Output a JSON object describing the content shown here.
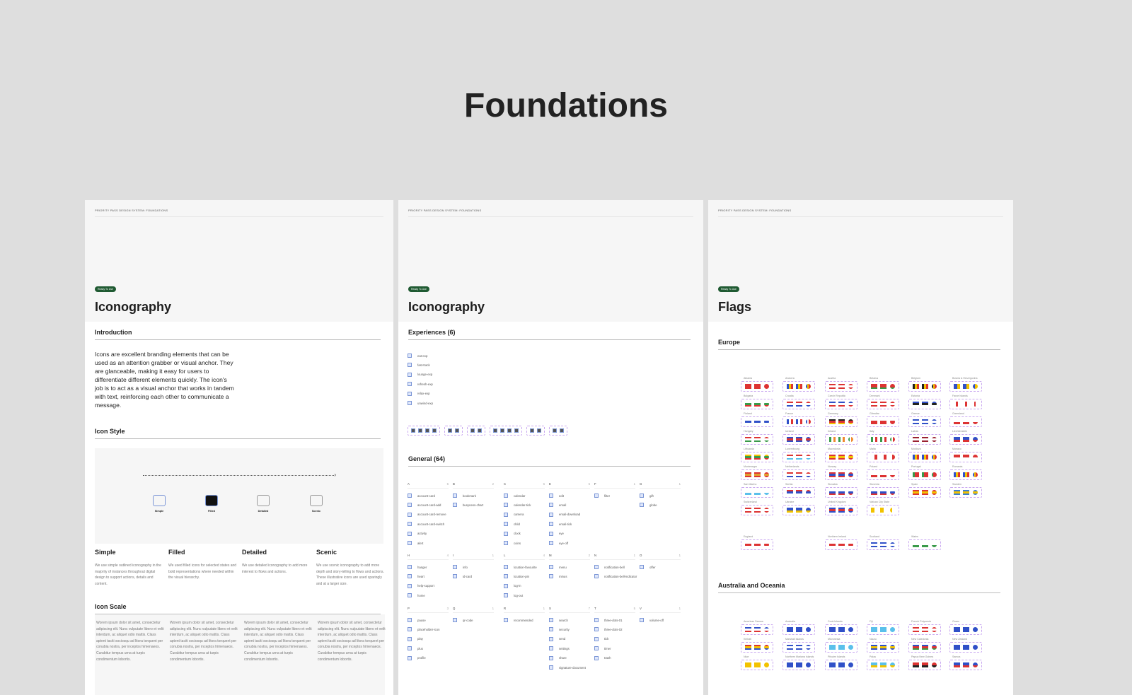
{
  "page_title": "Foundations",
  "panels": [
    {
      "breadcrumb": "PRIORITY PASS DESIGN SYSTEM: FOUNDATIONS",
      "badge": "Ready To Use",
      "title": "Iconography",
      "intro_heading": "Introduction",
      "intro_text": "Icons are excellent branding elements that can be used as an attention grabber or visual anchor. They are glanceable, making it easy for users to differentiate different elements quickly. The icon's job is to act as a visual anchor that works in tandem with text, reinforcing each other to communicate a message.",
      "style_heading": "Icon Style",
      "styles": [
        {
          "label": "Simple",
          "heading": "Simple",
          "text": "We use simple outlined iconography in the majority of instances throughout digital design to support actions, details and content."
        },
        {
          "label": "Filled",
          "heading": "Filled",
          "text": "We used filled icons for selected states and bold representations where needed within the visual hierarchy."
        },
        {
          "label": "Detailed",
          "heading": "Detailed",
          "text": "We use detailed iconography to add more interest to flows and actions."
        },
        {
          "label": "Scenic",
          "heading": "Scenic",
          "text": "We use scenic iconography to add more depth and story-telling to flows and actions. These illustrative icons are used sparingly and at a larger size."
        }
      ],
      "scale_heading": "Icon Scale",
      "scale_texts": [
        "Worem ipsum dolor sit amet, consectetur adipiscing elit. Nunc vulputate libero et velit interdum, ac aliquet odio mattis. Class aptent taciti sociosqu ad litora torquent per conubia nostra, per inceptos himenaeos. Curabitur tempus urna at turpis condimentum lobortis.",
        "Worem ipsum dolor sit amet, consectetur adipiscing elit. Nunc vulputate libero et velit interdum, ac aliquet odio mattis. Class aptent taciti sociosqu ad litora torquent per conubia nostra, per inceptos himenaeos. Curabitur tempus urna at turpis condimentum lobortis.",
        "Worem ipsum dolor sit amet, consectetur adipiscing elit. Nunc vulputate libero et velit interdum, ac aliquet odio mattis. Class aptent taciti sociosqu ad litora torquent per conubia nostra, per inceptos himenaeos. Curabitur tempus urna at turpis condimentum lobortis.",
        "Worem ipsum dolor sit amet, consectetur adipiscing elit. Nunc vulputate libero et velit interdum, ac aliquet odio mattis. Class aptent taciti sociosqu ad litora torquent per conubia nostra, per inceptos himenaeos. Curabitur tempus urna at turpis condimentum lobortis."
      ]
    },
    {
      "breadcrumb": "PRIORITY PASS DESIGN SYSTEM: FOUNDATIONS",
      "badge": "Ready To Use",
      "title": "Iconography",
      "experiences_heading": "Experiences (6)",
      "experiences": [
        "eat-exp",
        "fast-track",
        "lounge-exp",
        "refresh-exp",
        "relax-exp",
        "unwind-exp"
      ],
      "general_heading": "General (64)",
      "groups": [
        {
          "letter": "A",
          "count": "6",
          "items": [
            "account-card",
            "account-card-add",
            "account-card-remove",
            "account-card-switch",
            "activity",
            "alert"
          ]
        },
        {
          "letter": "B",
          "count": "2",
          "items": [
            "bookmark",
            "busyness-chart"
          ]
        },
        {
          "letter": "C",
          "count": "6",
          "items": [
            "calendar",
            "calendar-tick",
            "camera",
            "child",
            "clock",
            "coins"
          ]
        },
        {
          "letter": "E",
          "count": "6",
          "items": [
            "edit",
            "email",
            "email-download",
            "email-tick",
            "eye",
            "eye-off"
          ]
        },
        {
          "letter": "F",
          "count": "1",
          "items": [
            "filter"
          ]
        },
        {
          "letter": "G",
          "count": "1",
          "items": [
            "gift",
            "globe"
          ]
        },
        {
          "letter": "H",
          "count": "4",
          "items": [
            "hanger",
            "heart",
            "help-support",
            "home"
          ]
        },
        {
          "letter": "I",
          "count": "1",
          "items": [
            "info",
            "id-card"
          ]
        },
        {
          "letter": "L",
          "count": "4",
          "items": [
            "location-favourite",
            "location-pin",
            "log-in",
            "log-out"
          ]
        },
        {
          "letter": "M",
          "count": "2",
          "items": [
            "menu",
            "minus"
          ]
        },
        {
          "letter": "N",
          "count": "1",
          "items": [
            "notification-bell",
            "notification-bell-indicator"
          ]
        },
        {
          "letter": "O",
          "count": "1",
          "items": [
            "offer"
          ]
        },
        {
          "letter": "P",
          "count": "3",
          "items": [
            "pause",
            "placeholder-icon",
            "play",
            "plus",
            "profile"
          ]
        },
        {
          "letter": "Q",
          "count": "1",
          "items": [
            "qr-code"
          ]
        },
        {
          "letter": "R",
          "count": "1",
          "items": [
            "recommended"
          ]
        },
        {
          "letter": "S",
          "count": "7",
          "items": [
            "search",
            "security",
            "send",
            "settings",
            "share",
            "signature-document"
          ]
        },
        {
          "letter": "T",
          "count": "5",
          "items": [
            "three-dots-01",
            "three-dots-02",
            "tick",
            "timer",
            "trash"
          ]
        },
        {
          "letter": "V",
          "count": "1",
          "items": [
            "volume-off"
          ]
        }
      ]
    },
    {
      "breadcrumb": "PRIORITY PASS DESIGN SYSTEM: FOUNDATIONS",
      "badge": "Ready To Use",
      "title": "Flags",
      "europe_heading": "Europe",
      "europe": [
        {
          "name": "Albania",
          "c": [
            "#d33",
            "#d33"
          ]
        },
        {
          "name": "Andorra",
          "c": [
            "#3050c8",
            "#f2c200",
            "#d33"
          ],
          "v": 1
        },
        {
          "name": "Austria",
          "c": [
            "#d33",
            "#fff",
            "#d33"
          ]
        },
        {
          "name": "Belarus",
          "c": [
            "#d33",
            "#d33",
            "#3a9a4a"
          ]
        },
        {
          "name": "Belgium",
          "c": [
            "#222",
            "#f2c200",
            "#d33"
          ],
          "v": 1
        },
        {
          "name": "Bosnia & Herzegovina",
          "c": [
            "#3050c8",
            "#f2c200"
          ],
          "v": 1
        },
        {
          "name": "Bulgaria",
          "c": [
            "#fff",
            "#3a9a4a",
            "#d33"
          ]
        },
        {
          "name": "Croatia",
          "c": [
            "#d33",
            "#fff",
            "#3050c8"
          ]
        },
        {
          "name": "Czech Republic",
          "c": [
            "#3050c8",
            "#fff",
            "#d33"
          ]
        },
        {
          "name": "Denmark",
          "c": [
            "#d33",
            "#fff",
            "#d33"
          ]
        },
        {
          "name": "Estonia",
          "c": [
            "#3050c8",
            "#222",
            "#fff"
          ]
        },
        {
          "name": "Faroe Islands",
          "c": [
            "#fff",
            "#d33",
            "#fff"
          ],
          "v": 1
        },
        {
          "name": "Finland",
          "c": [
            "#fff",
            "#3050c8",
            "#fff"
          ]
        },
        {
          "name": "France",
          "c": [
            "#3050c8",
            "#fff",
            "#d33"
          ],
          "v": 1
        },
        {
          "name": "Germany",
          "c": [
            "#222",
            "#d33",
            "#f2c200"
          ]
        },
        {
          "name": "Gibraltar",
          "c": [
            "#fff",
            "#d33",
            "#d33"
          ]
        },
        {
          "name": "Greece",
          "c": [
            "#3050c8",
            "#fff",
            "#3050c8"
          ]
        },
        {
          "name": "Greenland",
          "c": [
            "#fff",
            "#d33"
          ]
        },
        {
          "name": "Hungary",
          "c": [
            "#d33",
            "#fff",
            "#3a9a4a"
          ]
        },
        {
          "name": "Iceland",
          "c": [
            "#3050c8",
            "#d33",
            "#3050c8"
          ]
        },
        {
          "name": "Ireland",
          "c": [
            "#3a9a4a",
            "#fff",
            "#f08a30"
          ],
          "v": 1
        },
        {
          "name": "Italy",
          "c": [
            "#3a9a4a",
            "#fff",
            "#d33"
          ],
          "v": 1
        },
        {
          "name": "Latvia",
          "c": [
            "#9b2232",
            "#fff",
            "#9b2232"
          ]
        },
        {
          "name": "Liechtenstein",
          "c": [
            "#3050c8",
            "#d33"
          ]
        },
        {
          "name": "Lithuania",
          "c": [
            "#f2c200",
            "#3a9a4a",
            "#d33"
          ]
        },
        {
          "name": "Luxembourg",
          "c": [
            "#d33",
            "#fff",
            "#5bc0eb"
          ]
        },
        {
          "name": "Macedonia",
          "c": [
            "#d33",
            "#f2c200",
            "#d33"
          ]
        },
        {
          "name": "Malta",
          "c": [
            "#fff",
            "#d33"
          ],
          "v": 1
        },
        {
          "name": "Moldova",
          "c": [
            "#3050c8",
            "#f2c200",
            "#d33"
          ],
          "v": 1
        },
        {
          "name": "Monaco",
          "c": [
            "#d33",
            "#fff"
          ]
        },
        {
          "name": "Montenegro",
          "c": [
            "#d33",
            "#e0a030",
            "#d33"
          ]
        },
        {
          "name": "Netherlands",
          "c": [
            "#d33",
            "#fff",
            "#3050c8"
          ]
        },
        {
          "name": "Norway",
          "c": [
            "#d33",
            "#3050c8",
            "#d33"
          ]
        },
        {
          "name": "Poland",
          "c": [
            "#fff",
            "#d33"
          ]
        },
        {
          "name": "Portugal",
          "c": [
            "#3a9a4a",
            "#d33",
            "#d33"
          ],
          "v": 1
        },
        {
          "name": "Romania",
          "c": [
            "#3050c8",
            "#f2c200",
            "#d33"
          ],
          "v": 1
        },
        {
          "name": "San Marino",
          "c": [
            "#fff",
            "#5bc0eb"
          ]
        },
        {
          "name": "Serbia",
          "c": [
            "#d33",
            "#3050c8",
            "#fff"
          ]
        },
        {
          "name": "Slovakia",
          "c": [
            "#fff",
            "#3050c8",
            "#d33"
          ]
        },
        {
          "name": "Slovenia",
          "c": [
            "#fff",
            "#3050c8",
            "#d33"
          ]
        },
        {
          "name": "Spain",
          "c": [
            "#d33",
            "#f2c200",
            "#d33"
          ]
        },
        {
          "name": "Sweden",
          "c": [
            "#3a7fd0",
            "#f2c200",
            "#3a7fd0"
          ]
        },
        {
          "name": "Switzerland",
          "c": [
            "#d33",
            "#fff",
            "#d33"
          ]
        },
        {
          "name": "Ukraine",
          "c": [
            "#3050c8",
            "#f2c200"
          ]
        },
        {
          "name": "United Kingdom",
          "c": [
            "#3050c8",
            "#d33",
            "#3050c8"
          ]
        },
        {
          "name": "Vatican City State",
          "c": [
            "#f2c200",
            "#fff"
          ],
          "v": 1
        }
      ],
      "uk_nations": [
        {
          "name": "England",
          "c": [
            "#fff",
            "#d33",
            "#fff"
          ]
        },
        {
          "name": "Northern Ireland",
          "c": [
            "#fff",
            "#d33",
            "#fff"
          ]
        },
        {
          "name": "Scotland",
          "c": [
            "#3050c8",
            "#fff",
            "#3050c8"
          ]
        },
        {
          "name": "Wales",
          "c": [
            "#fff",
            "#3a9a4a"
          ]
        }
      ],
      "oceania_heading": "Australia and Oceania",
      "oceania": [
        {
          "name": "American Samoa",
          "c": [
            "#3050c8",
            "#fff",
            "#d33"
          ]
        },
        {
          "name": "Australia",
          "c": [
            "#3050c8",
            "#3050c8"
          ]
        },
        {
          "name": "Cook Islands",
          "c": [
            "#3050c8",
            "#3050c8"
          ]
        },
        {
          "name": "Fiji",
          "c": [
            "#5bc0eb",
            "#5bc0eb"
          ]
        },
        {
          "name": "French Polynesia",
          "c": [
            "#d33",
            "#fff",
            "#d33"
          ]
        },
        {
          "name": "Guam",
          "c": [
            "#3050c8",
            "#3050c8"
          ]
        },
        {
          "name": "Kiribati",
          "c": [
            "#d33",
            "#f2c200",
            "#3050c8"
          ]
        },
        {
          "name": "Marshall Islands",
          "c": [
            "#3050c8",
            "#fff",
            "#3050c8"
          ]
        },
        {
          "name": "Micronesia",
          "c": [
            "#5bc0eb",
            "#5bc0eb"
          ]
        },
        {
          "name": "Nauru",
          "c": [
            "#3050c8",
            "#f2c200",
            "#3050c8"
          ]
        },
        {
          "name": "New Caledonia",
          "c": [
            "#3050c8",
            "#d33",
            "#3a9a4a"
          ]
        },
        {
          "name": "New Zealand",
          "c": [
            "#3050c8",
            "#3050c8"
          ]
        },
        {
          "name": "Niue",
          "c": [
            "#f2c200",
            "#f2c200"
          ]
        },
        {
          "name": "Northern Mariana Islands",
          "c": [
            "#3050c8",
            "#3050c8"
          ]
        },
        {
          "name": "Pitcairn Islands",
          "c": [
            "#3050c8",
            "#3050c8"
          ]
        },
        {
          "name": "Palau",
          "c": [
            "#5bc0eb",
            "#f2c200"
          ]
        },
        {
          "name": "Papua New Guinea",
          "c": [
            "#d33",
            "#222"
          ]
        },
        {
          "name": "Samoa",
          "c": [
            "#3050c8",
            "#d33"
          ]
        }
      ]
    }
  ]
}
